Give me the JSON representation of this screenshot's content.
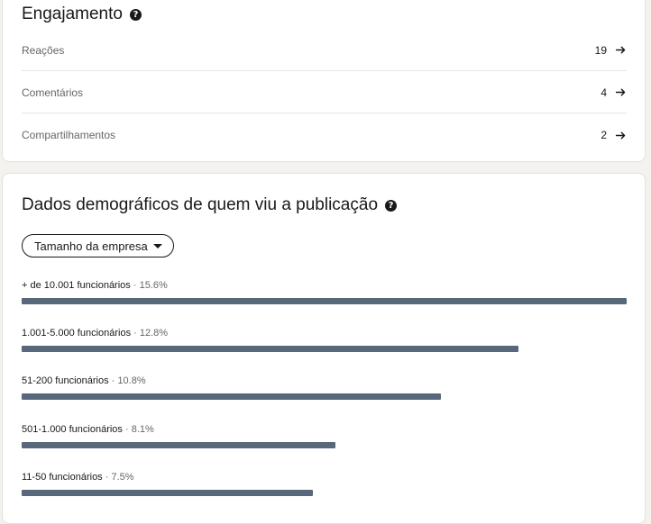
{
  "engagement": {
    "title": "Engajamento",
    "metrics": [
      {
        "label": "Reações",
        "value": "19"
      },
      {
        "label": "Comentários",
        "value": "4"
      },
      {
        "label": "Compartilhamentos",
        "value": "2"
      }
    ]
  },
  "demographics": {
    "title": "Dados demográficos de quem viu a publicação",
    "filter_label": "Tamanho da empresa",
    "bars": [
      {
        "label": "+ de 10.001 funcionários",
        "percent": "15.6%",
        "value": 15.6
      },
      {
        "label": "1.001-5.000 funcionários",
        "percent": "12.8%",
        "value": 12.8
      },
      {
        "label": "51-200 funcionários",
        "percent": "10.8%",
        "value": 10.8
      },
      {
        "label": "501-1.000 funcionários",
        "percent": "8.1%",
        "value": 8.1
      },
      {
        "label": "11-50 funcionários",
        "percent": "7.5%",
        "value": 7.5
      }
    ]
  },
  "colors": {
    "bar": "#56687a",
    "text": "#191919",
    "muted": "#666666"
  },
  "icons": {
    "help": "question-circle-icon",
    "arrow": "arrow-right-icon",
    "caret": "caret-down-icon"
  },
  "help_glyph": "?",
  "percent_separator": " · "
}
